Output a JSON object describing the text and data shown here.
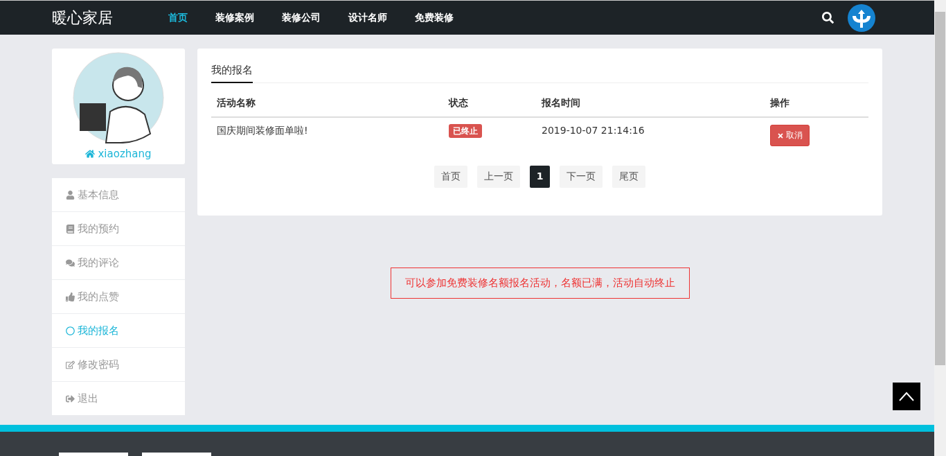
{
  "brand": "暖心家居",
  "nav": [
    {
      "label": "首页",
      "selected": true
    },
    {
      "label": "装修案例",
      "selected": false
    },
    {
      "label": "装修公司",
      "selected": false
    },
    {
      "label": "设计名师",
      "selected": false
    },
    {
      "label": "免费装修",
      "selected": false
    }
  ],
  "profile": {
    "username": "xiaozhang"
  },
  "sidebar": {
    "items": [
      {
        "label": "基本信息",
        "selected": false
      },
      {
        "label": "我的预约",
        "selected": false
      },
      {
        "label": "我的评论",
        "selected": false
      },
      {
        "label": "我的点赞",
        "selected": false
      },
      {
        "label": "我的报名",
        "selected": true
      },
      {
        "label": "修改密码",
        "selected": false
      },
      {
        "label": "退出",
        "selected": false
      }
    ]
  },
  "panel": {
    "tab": "我的报名",
    "table": {
      "columns": [
        "活动名称",
        "状态",
        "报名时间",
        "操作"
      ],
      "rows": [
        {
          "name": "国庆期间装修面单啦!",
          "status": "已终止",
          "time": "2019-10-07 21:14:16",
          "action": "取消"
        }
      ]
    },
    "pagination": [
      {
        "label": "首页",
        "selected": false
      },
      {
        "label": "上一页",
        "selected": false
      },
      {
        "label": "1",
        "selected": true
      },
      {
        "label": "下一页",
        "selected": false
      },
      {
        "label": "尾页",
        "selected": false
      }
    ]
  },
  "notice": "可以参加免费装修名额报名活动，名额已满，活动自动终止"
}
